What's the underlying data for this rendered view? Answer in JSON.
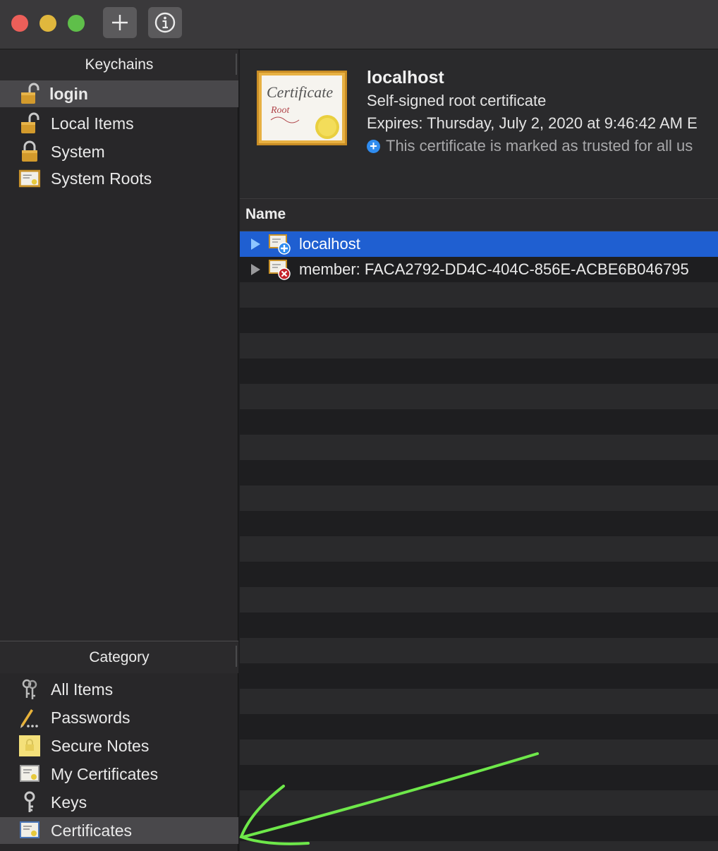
{
  "toolbar": {
    "add_label": "+",
    "info_label": "i"
  },
  "sidebar": {
    "keychains_header": "Keychains",
    "keychains": [
      {
        "label": "login",
        "icon": "unlocked-padlock-icon"
      },
      {
        "label": "Local Items",
        "icon": "unlocked-padlock-icon"
      },
      {
        "label": "System",
        "icon": "locked-padlock-icon"
      },
      {
        "label": "System Roots",
        "icon": "certificate-icon"
      }
    ],
    "category_header": "Category",
    "categories": [
      {
        "label": "All Items",
        "icon": "keys-icon"
      },
      {
        "label": "Passwords",
        "icon": "pencil-dots-icon"
      },
      {
        "label": "Secure Notes",
        "icon": "note-icon"
      },
      {
        "label": "My Certificates",
        "icon": "certificate-user-icon"
      },
      {
        "label": "Keys",
        "icon": "key-icon"
      },
      {
        "label": "Certificates",
        "icon": "certificate-icon"
      }
    ]
  },
  "detail": {
    "title": "localhost",
    "subtitle": "Self-signed root certificate",
    "expires": "Expires: Thursday, July 2, 2020 at 9:46:42 AM E",
    "trust": "This certificate is marked as trusted for all us",
    "cert_text_top": "Certificate",
    "cert_text_bottom": "Root"
  },
  "table": {
    "column_name": "Name",
    "rows": [
      {
        "label": "localhost",
        "badge": "plus",
        "selected": true
      },
      {
        "label": "member: FACA2792-DD4C-404C-856E-ACBE6B046795",
        "badge": "x",
        "selected": false
      }
    ]
  },
  "colors": {
    "selection_blue": "#1f5fd1",
    "annotation_green": "#6ee84a",
    "trust_blue": "#2f8cf0"
  }
}
